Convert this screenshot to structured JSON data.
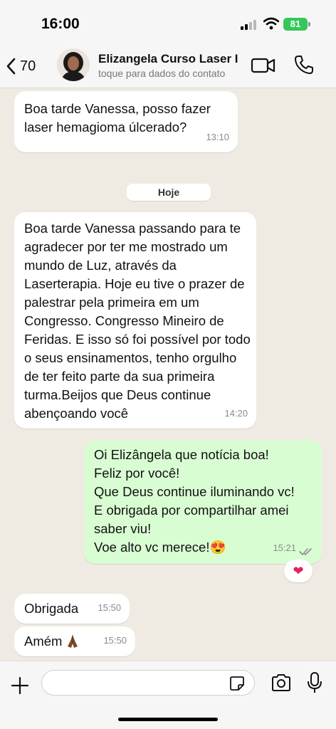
{
  "status_bar": {
    "time": "16:00",
    "battery": "81"
  },
  "header": {
    "back_count": "70",
    "contact_name": "Elizangela Curso Laser I",
    "contact_subtitle": "toque para dados do contato"
  },
  "messages": [
    {
      "direction": "incoming",
      "text": "Boa tarde Vanessa, posso fazer laser hemagioma úlcerado?",
      "time": "13:10"
    },
    {
      "direction": "incoming",
      "text": "Boa tarde Vanessa passando para te agradecer por ter me mostrado um mundo de Luz, através da Laserterapia. Hoje eu tive o prazer de palestrar pela primeira em um Congresso. Congresso Mineiro de Feridas. E isso só foi possível por todo o seus ensinamentos, tenho orgulho de ter feito parte da sua primeira turma.Beijos que Deus continue abençoando você",
      "time": "14:20"
    },
    {
      "direction": "outgoing",
      "text": "Oi Elizângela que notícia boa!\nFeliz por você!\nQue Deus continue iluminando vc!\nE obrigada por compartilhar amei saber viu!\nVoe alto vc merece!😍",
      "time": "15:21",
      "reaction": "❤"
    },
    {
      "direction": "incoming",
      "text": "Obrigada",
      "time": "15:50"
    },
    {
      "direction": "incoming",
      "text": "Amém",
      "time": "15:50",
      "emoji": "pray-icon"
    }
  ],
  "date_separator": "Hoje",
  "input": {
    "placeholder": ""
  },
  "icons": {
    "back": "chevron-left-icon",
    "video": "video-camera-icon",
    "call": "phone-icon",
    "plus": "plus-icon",
    "sticker": "sticker-icon",
    "camera": "camera-icon",
    "mic": "microphone-icon",
    "read": "double-check-icon"
  },
  "colors": {
    "background": "#efeae2",
    "incoming_bubble": "#ffffff",
    "outgoing_bubble": "#d9fdd3",
    "battery": "#35c759",
    "read_ticks": "#8a8a8a"
  }
}
